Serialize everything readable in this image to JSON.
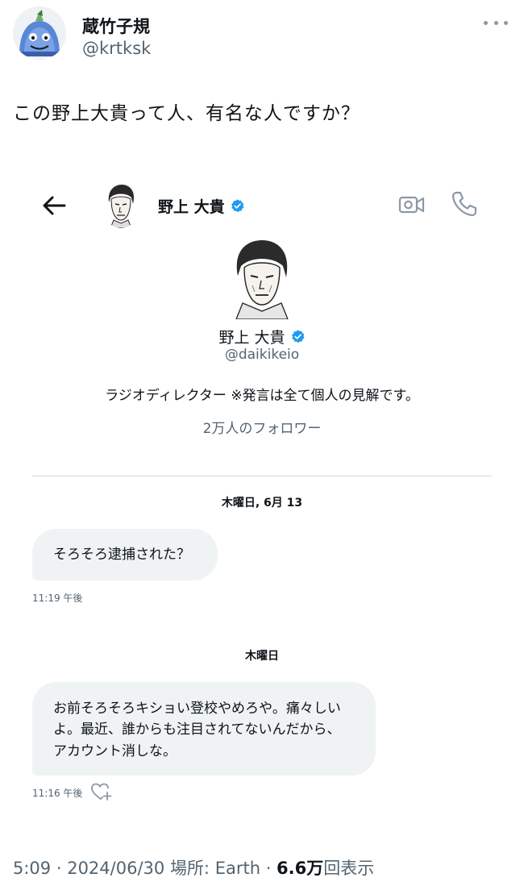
{
  "tweet": {
    "author_name": "蔵竹子規",
    "author_handle": "@krtksk",
    "text": "この野上大貴って人、有名な人ですか？",
    "meta": {
      "time": "5:09",
      "separator": " · ",
      "date": "2024/06/30",
      "location": "場所: Earth",
      "views_count": "6.6万",
      "views_suffix": "回表示"
    }
  },
  "dm": {
    "header_name": "野上 大貴",
    "profile": {
      "name": "野上 大貴",
      "handle": "@daikikeio",
      "bio": "ラジオディレクター ※発言は全て個人の見解です。",
      "followers": "2万人のフォロワー"
    },
    "conversation": [
      {
        "date_label": "木曜日, 6月 13",
        "message": "そろそろ逮捕された？",
        "time": "11:19 午後"
      },
      {
        "date_label": "木曜日",
        "message_lines": [
          "お前そろそろキショい登校やめろや。痛々しい",
          "よ。最近、誰からも注目されてないんだから、",
          "アカウント消しな。"
        ],
        "time": "11:16 午後"
      }
    ]
  },
  "icons": {
    "back": "back-arrow-icon",
    "verified": "verified-badge-icon",
    "video": "video-call-icon",
    "phone": "phone-call-icon",
    "react": "heart-plus-icon",
    "more": "more-dots-icon"
  },
  "colors": {
    "verified_blue": "#1d9bf0",
    "bubble_bg": "#eff3f4",
    "secondary_text": "#536471",
    "primary_text": "#0f1419"
  }
}
